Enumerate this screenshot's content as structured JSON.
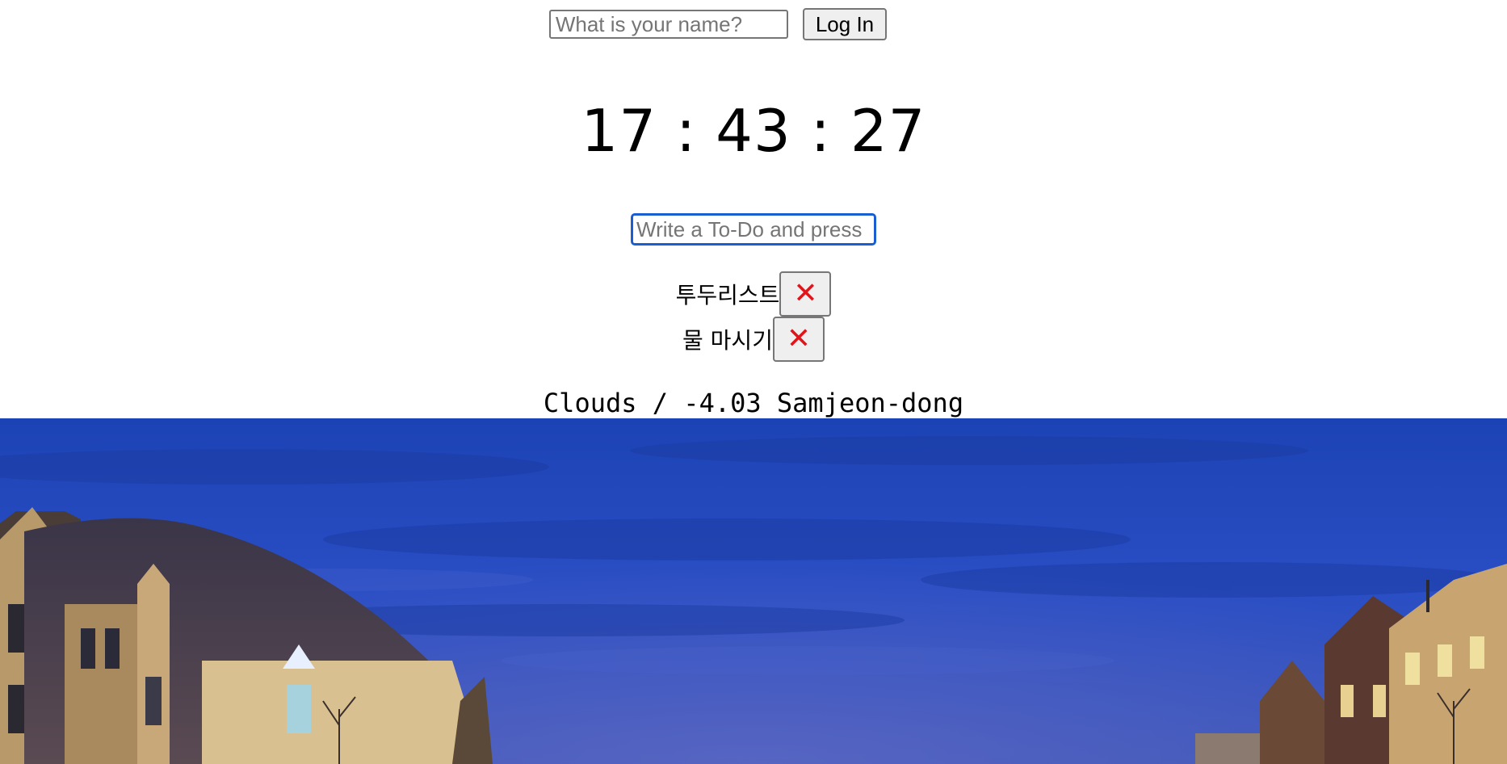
{
  "login": {
    "name_placeholder": "What is your name?",
    "button_label": "Log In"
  },
  "clock": {
    "time": "17 : 43 : 27"
  },
  "todo": {
    "input_placeholder": "Write a To-Do and press",
    "items": [
      {
        "text": "투두리스트",
        "delete_label": "✕"
      },
      {
        "text": "물 마시기",
        "delete_label": "✕"
      }
    ]
  },
  "weather": {
    "text": "Clouds / -4.03 Samjeon-dong"
  },
  "colors": {
    "accent": "#1a5fd1",
    "delete_icon": "#e0141a",
    "sky_top": "#1d45b8",
    "sky_bottom": "#2b4fc0"
  }
}
